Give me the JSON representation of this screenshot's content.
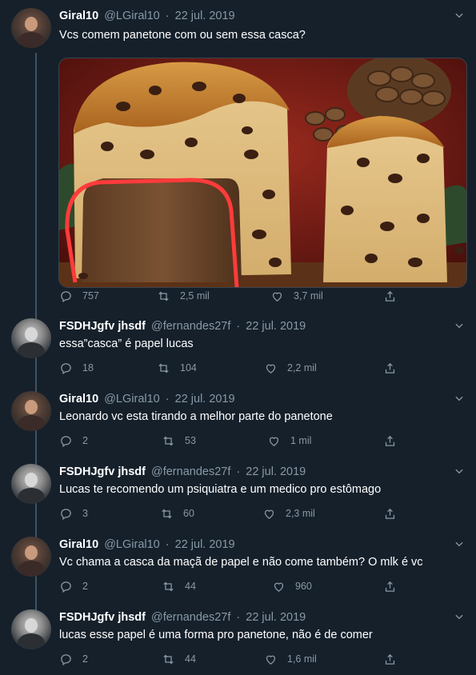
{
  "tweets": [
    {
      "name": "Giral10",
      "handle": "@LGiral10",
      "date": "22 jul. 2019",
      "avatar": "avatar-giral10",
      "text": "Vcs comem panetone com ou sem essa casca?",
      "has_media": true,
      "replies": "757",
      "retweets": "2,5 mil",
      "likes": "3,7 mil"
    },
    {
      "name": "FSDHJgfv jhsdf",
      "handle": "@fernandes27f",
      "date": "22 jul. 2019",
      "avatar": "avatar-fernandes27f",
      "text": "essa”casca” é papel lucas",
      "replies": "18",
      "retweets": "104",
      "likes": "2,2 mil"
    },
    {
      "name": "Giral10",
      "handle": "@LGiral10",
      "date": "22 jul. 2019",
      "avatar": "avatar-giral10",
      "text": "Leonardo vc esta tirando a melhor parte do panetone",
      "replies": "2",
      "retweets": "53",
      "likes": "1 mil"
    },
    {
      "name": "FSDHJgfv jhsdf",
      "handle": "@fernandes27f",
      "date": "22 jul. 2019",
      "avatar": "avatar-fernandes27f",
      "text": "Lucas te recomendo um psiquiatra e um medico pro estômago",
      "replies": "3",
      "retweets": "60",
      "likes": "2,3 mil"
    },
    {
      "name": "Giral10",
      "handle": "@LGiral10",
      "date": "22 jul. 2019",
      "avatar": "avatar-giral10",
      "text": "Vc chama a casca da maçã de papel e não come também? O mlk é vc",
      "replies": "2",
      "retweets": "44",
      "likes": "960"
    },
    {
      "name": "FSDHJgfv jhsdf",
      "handle": "@fernandes27f",
      "date": "22 jul. 2019",
      "avatar": "avatar-fernandes27f",
      "text": "lucas esse papel é uma forma pro panetone, não é de comer",
      "replies": "2",
      "retweets": "44",
      "likes": "1,6 mil"
    }
  ],
  "icons": {
    "reply": "reply-icon",
    "retweet": "retweet-icon",
    "like": "like-icon",
    "share": "share-icon",
    "more": "chevron-down-icon"
  },
  "colors": {
    "background": "#15202b",
    "secondary_text": "#8899a6",
    "thread_line": "#3d5466",
    "highlight_circle": "#ff3b3b"
  }
}
